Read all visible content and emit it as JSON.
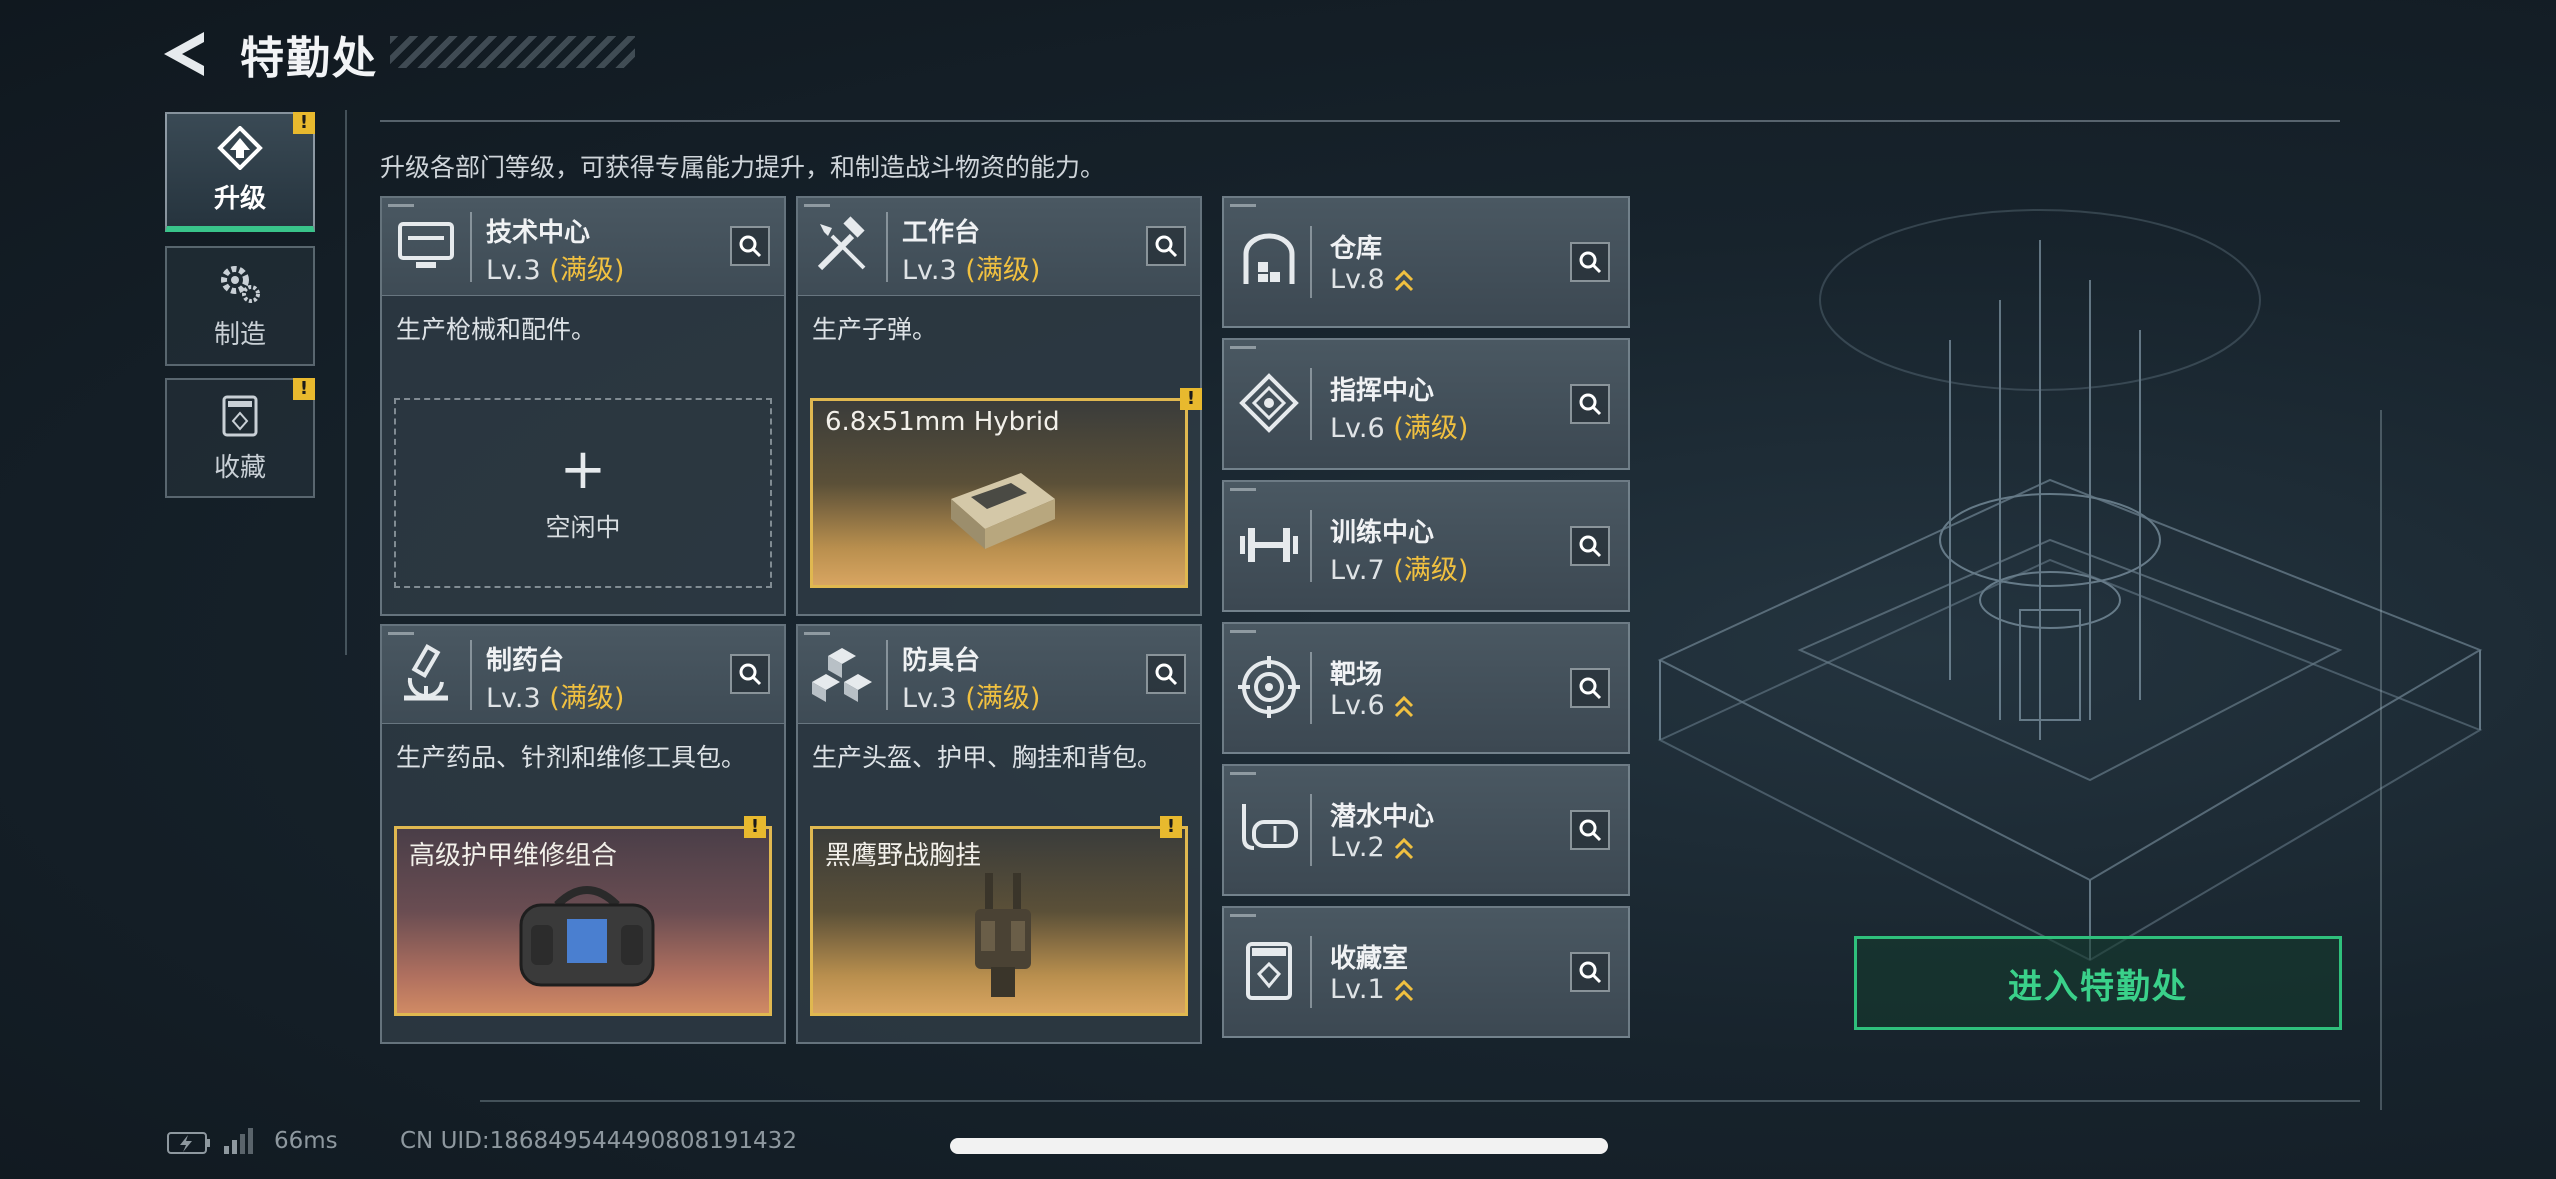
{
  "header": {
    "title": "特勤处"
  },
  "side_nav": [
    {
      "label": "升级",
      "active": true,
      "warning": true,
      "icon": "upgrade-icon"
    },
    {
      "label": "制造",
      "active": false,
      "warning": false,
      "icon": "gear-icon"
    },
    {
      "label": "收藏",
      "active": false,
      "warning": true,
      "icon": "collection-icon"
    }
  ],
  "subtitle": "升级各部门等级，可获得专属能力提升，和制造战斗物资的能力。",
  "cards": [
    {
      "name": "技术中心",
      "level": "Lv.3",
      "max": "(满级)",
      "desc": "生产枪械和配件。",
      "slot_empty": "空闲中",
      "slot_plus": "+",
      "icon": "monitor-icon"
    },
    {
      "name": "工作台",
      "level": "Lv.3",
      "max": "(满级)",
      "desc": "生产子弹。",
      "slot_item": "6.8x51mm Hybrid",
      "icon": "tools-icon"
    },
    {
      "name": "制药台",
      "level": "Lv.3",
      "max": "(满级)",
      "desc": "生产药品、针剂和维修工具包。",
      "slot_item": "高级护甲维修组合",
      "icon": "microscope-icon"
    },
    {
      "name": "防具台",
      "level": "Lv.3",
      "max": "(满级)",
      "desc": "生产头盔、护甲、胸挂和背包。",
      "slot_item": "黑鹰野战胸挂",
      "icon": "cubes-icon"
    }
  ],
  "small_cards": [
    {
      "name": "仓库",
      "level": "Lv.8",
      "max": "",
      "icon": "warehouse-icon",
      "upgradable": true
    },
    {
      "name": "指挥中心",
      "level": "Lv.6",
      "max": "(满级)",
      "icon": "command-icon",
      "upgradable": false
    },
    {
      "name": "训练中心",
      "level": "Lv.7",
      "max": "(满级)",
      "icon": "dumbbell-icon",
      "upgradable": false
    },
    {
      "name": "靶场",
      "level": "Lv.6",
      "max": "",
      "icon": "target-icon",
      "upgradable": true
    },
    {
      "name": "潜水中心",
      "level": "Lv.2",
      "max": "",
      "icon": "diving-mask-icon",
      "upgradable": true
    },
    {
      "name": "收藏室",
      "level": "Lv.1",
      "max": "",
      "icon": "vault-icon",
      "upgradable": true
    }
  ],
  "enter_button": "进入特勤处",
  "status": {
    "ping": "66ms",
    "uid": "CN UID:18684954449080819143​2"
  },
  "colors": {
    "accent_green": "#39c48a",
    "max_level": "#f0c040",
    "warning": "#e8b92e"
  }
}
